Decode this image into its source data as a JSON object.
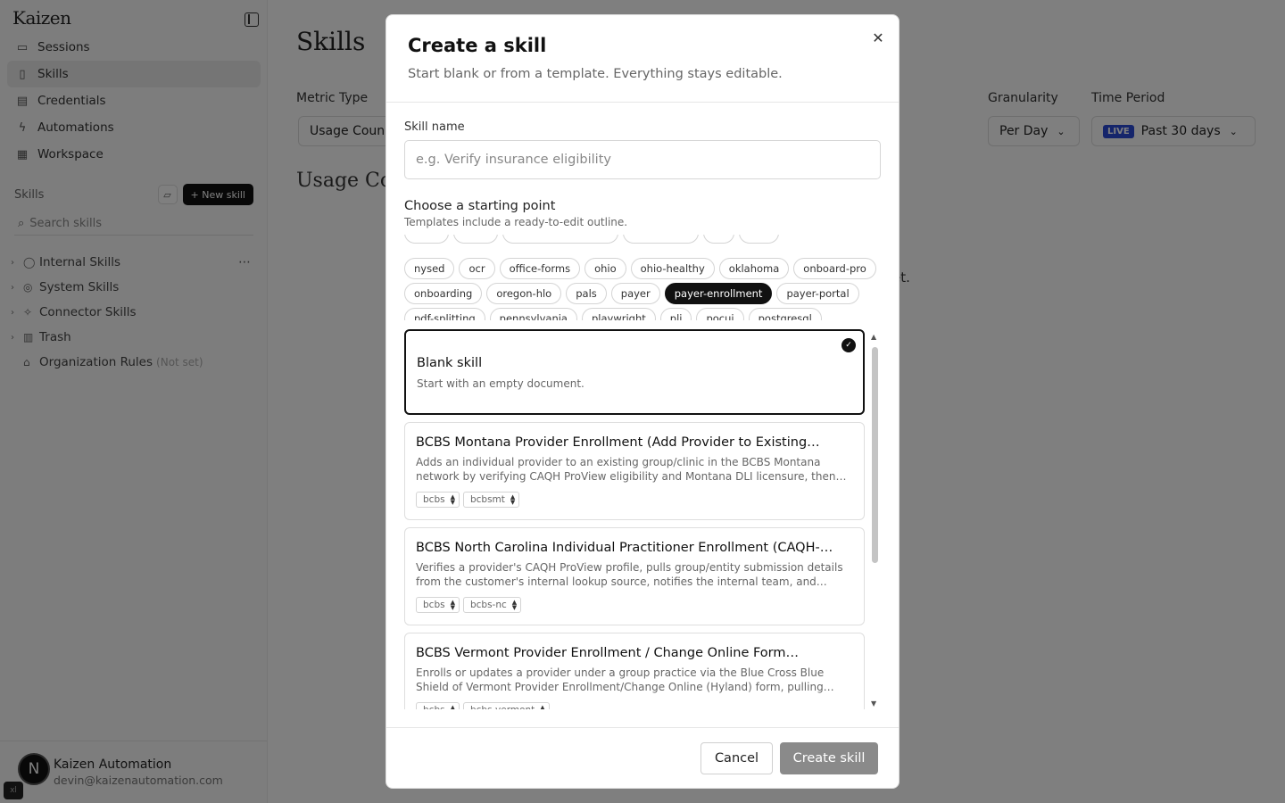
{
  "app": {
    "brand": "Kaizen",
    "nav": [
      {
        "label": "Sessions",
        "icon": "sessions-icon"
      },
      {
        "label": "Skills",
        "icon": "book-icon"
      },
      {
        "label": "Credentials",
        "icon": "credentials-icon"
      },
      {
        "label": "Automations",
        "icon": "bolt-icon"
      },
      {
        "label": "Workspace",
        "icon": "grid-icon"
      }
    ],
    "skills_section": {
      "label": "Skills",
      "new_button": "+ New skill",
      "search_placeholder": "Search skills"
    },
    "tree": [
      {
        "label": "Internal Skills"
      },
      {
        "label": "System Skills"
      },
      {
        "label": "Connector Skills"
      },
      {
        "label": "Trash"
      },
      {
        "label": "Organization Rules",
        "note": "(Not set)"
      }
    ],
    "user": {
      "initial": "N",
      "name": "Kaizen Automation",
      "email": "devin@kaizenautomation.com",
      "corner_badge": "xl"
    }
  },
  "main": {
    "title": "Skills",
    "metric_type_label": "Metric Type",
    "metric_type_value": "Usage Coun",
    "granularity_label": "Granularity",
    "granularity_value": "Per Day",
    "time_period_label": "Time Period",
    "live_badge": "LIVE",
    "time_period_value": "Past 30 days",
    "section_title": "Usage Co",
    "fragment": "et."
  },
  "modal": {
    "title": "Create a skill",
    "subtitle": "Start blank or from a template. Everything stays editable.",
    "name_label": "Skill name",
    "name_placeholder": "e.g. Verify insurance eligibility",
    "starting_point_title": "Choose a starting point",
    "starting_point_sub": "Templates include a ready-to-edit outline.",
    "tag_rows": [
      [
        "nysed",
        "ocr",
        "office-forms",
        "ohio",
        "ohio-healthy",
        "oklahoma",
        "onboard-pro"
      ],
      [
        "onboarding",
        "oregon-hlo",
        "pals",
        "payer",
        "payer-enrollment",
        "payer-portal"
      ],
      [
        "pdf-splitting",
        "pennsylvania",
        "playwright",
        "pli",
        "pocui",
        "postgresql"
      ]
    ],
    "active_tag": "payer-enrollment",
    "templates": [
      {
        "title": "Blank skill",
        "desc": "Start with an empty document.",
        "tags": []
      },
      {
        "title": "BCBS Montana Provider Enrollment (Add Provider to Existing…",
        "desc": "Adds an individual provider to an existing group/clinic in the BCBS Montana network by verifying CAQH ProView eligibility and Montana DLI licensure, then…",
        "tags": [
          "bcbs",
          "bcbsmt"
        ]
      },
      {
        "title": "BCBS North Carolina Individual Practitioner Enrollment (CAQH-…",
        "desc": "Verifies a provider's CAQH ProView profile, pulls group/entity submission details from the customer's internal lookup source, notifies the internal team, and…",
        "tags": [
          "bcbs",
          "bcbs-nc"
        ]
      },
      {
        "title": "BCBS Vermont Provider Enrollment / Change Online Form…",
        "desc": "Enrolls or updates a provider under a group practice via the Blue Cross Blue Shield of Vermont Provider Enrollment/Change Online (Hyland) form, pulling…",
        "tags": [
          "bcbs",
          "bcbs-vermont"
        ]
      }
    ],
    "cancel": "Cancel",
    "create": "Create skill"
  }
}
